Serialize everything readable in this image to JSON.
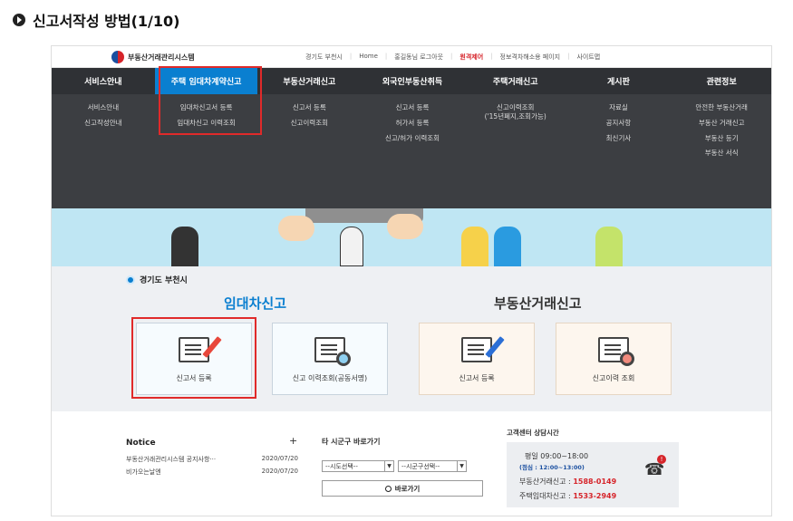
{
  "page": {
    "title": "신고서작성 방법(1/10)"
  },
  "site": {
    "logo_text": "부동산거래관리시스템",
    "util_links": [
      "경기도 부천시",
      "Home",
      "홍길동님 로그아웃",
      "원격제어",
      "정보격차해소용 페이지",
      "사이트맵"
    ]
  },
  "nav": {
    "items": [
      "서비스안내",
      "주택 임대차계약신고",
      "부동산거래신고",
      "외국인부동산취득",
      "주택거래신고",
      "게시판",
      "관련정보"
    ],
    "submenus": [
      [
        "서비스안내",
        "신고작성안내"
      ],
      [
        "임대차신고서 등록",
        "임대차신고 이력조회"
      ],
      [
        "신고서 등록",
        "신고이력조회"
      ],
      [
        "신고서 등록",
        "허가서 등록",
        "신고/허가 이력조회"
      ],
      [
        "신고이력조회",
        "('15년폐지,조회가능)"
      ],
      [
        "자료실",
        "공지사항",
        "최신기사"
      ],
      [
        "안전한 부동산거래",
        "부동산 거래신고",
        "부동산 등기",
        "부동산 서식"
      ]
    ]
  },
  "main": {
    "city": "경기도 부천시",
    "lease_title": "임대차신고",
    "trade_title": "부동산거래신고",
    "cards": [
      "신고서 등록",
      "신고 이력조회(공동서명)",
      "신고서 등록",
      "신고이력 조회"
    ]
  },
  "footer": {
    "notice_title": "Notice",
    "notice_plus": "+",
    "notices": [
      {
        "title": "부동산거래관리시스템 공지사항···",
        "date": "2020/07/20"
      },
      {
        "title": "비가오는날엔",
        "date": "2020/07/20"
      }
    ],
    "shortcut_title": "타 시군구 바로가기",
    "select1": "--시도선택--",
    "select2": "--시군구선택--",
    "go_label": "바로가기",
    "cs_title": "고객센터 상담시간",
    "cs_hours": "평일 09:00~18:00",
    "cs_lunch": "(점심 : 12:00~13:00)",
    "cs_trade_label": "부동산거래신고 : ",
    "cs_trade_phone": "1588-0149",
    "cs_lease_label": "주택임대차신고 : ",
    "cs_lease_phone": "1533-2949",
    "badge": "!"
  }
}
